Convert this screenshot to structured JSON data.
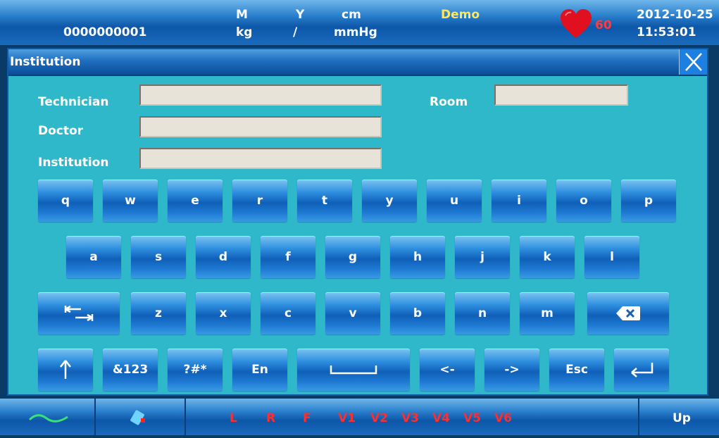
{
  "status": {
    "patient_id": "0000000001",
    "sex": "M",
    "age": "Y",
    "height_unit": "cm",
    "weight_unit": "kg",
    "separator": "/",
    "bp_unit": "mmHg",
    "mode": "Demo",
    "heart_rate": "60",
    "date": "2012-10-25",
    "time": "11:53:01"
  },
  "dialog": {
    "title": "Institution",
    "fields": {
      "technician_label": "Technician",
      "doctor_label": "Doctor",
      "institution_label": "Institution",
      "room_label": "Room",
      "technician_value": "",
      "doctor_value": "",
      "institution_value": "",
      "room_value": ""
    }
  },
  "keyboard": {
    "row1": [
      "q",
      "w",
      "e",
      "r",
      "t",
      "y",
      "u",
      "i",
      "o",
      "p"
    ],
    "row2": [
      "a",
      "s",
      "d",
      "f",
      "g",
      "h",
      "j",
      "k",
      "l"
    ],
    "row3": [
      "z",
      "x",
      "c",
      "v",
      "b",
      "n",
      "m"
    ],
    "row4": {
      "symbols": "&123",
      "special": "?#*",
      "lang": "En",
      "left": "<-",
      "right": "->",
      "esc": "Esc"
    }
  },
  "bottombar": {
    "leads": [
      "L",
      "R",
      "F",
      "V1",
      "V2",
      "V3",
      "V4",
      "V5",
      "V6"
    ],
    "up": "Up"
  },
  "colors": {
    "dialog_bg": "#2fb8c9",
    "lead_text": "#ff2d2d",
    "demo_text": "#ffe65a",
    "heart": "#e01020"
  }
}
